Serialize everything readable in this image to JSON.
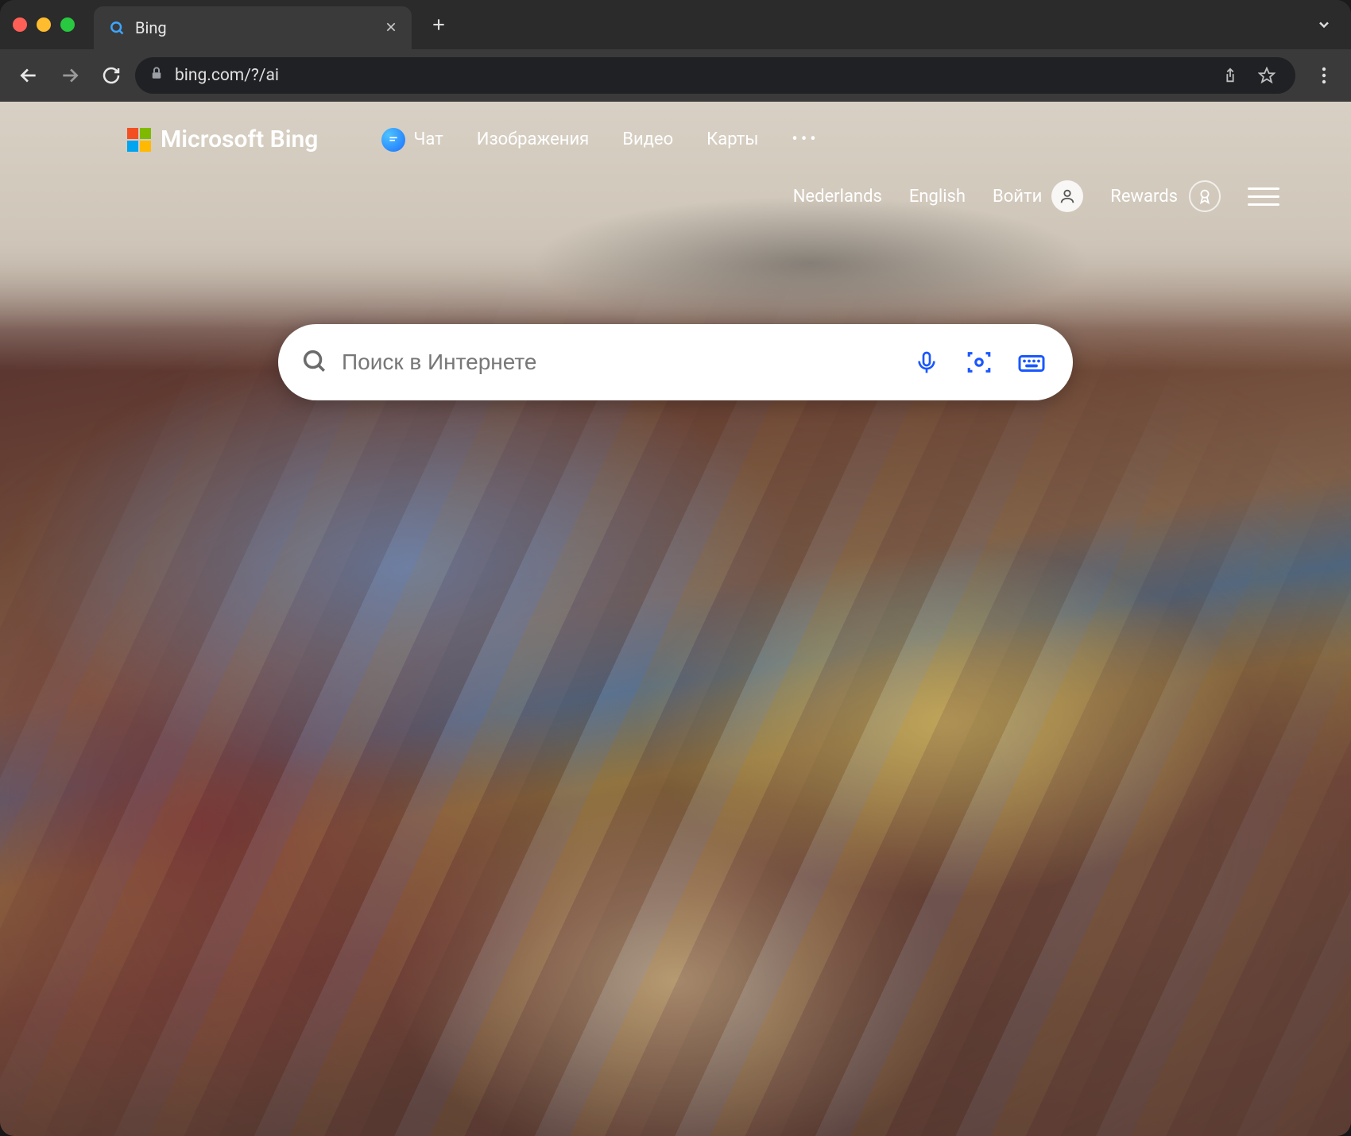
{
  "browser": {
    "tab": {
      "title": "Bing",
      "favicon": "search-icon"
    },
    "url": "bing.com/?/ai"
  },
  "bing": {
    "logo_text": "Microsoft Bing",
    "nav": {
      "chat": "Чат",
      "images": "Изображения",
      "video": "Видео",
      "maps": "Карты"
    },
    "secondary": {
      "lang1": "Nederlands",
      "lang2": "English",
      "signin": "Войти",
      "rewards": "Rewards"
    },
    "search": {
      "placeholder": "Поиск в Интернете"
    }
  },
  "colors": {
    "accent_blue": "#1a57ff"
  }
}
